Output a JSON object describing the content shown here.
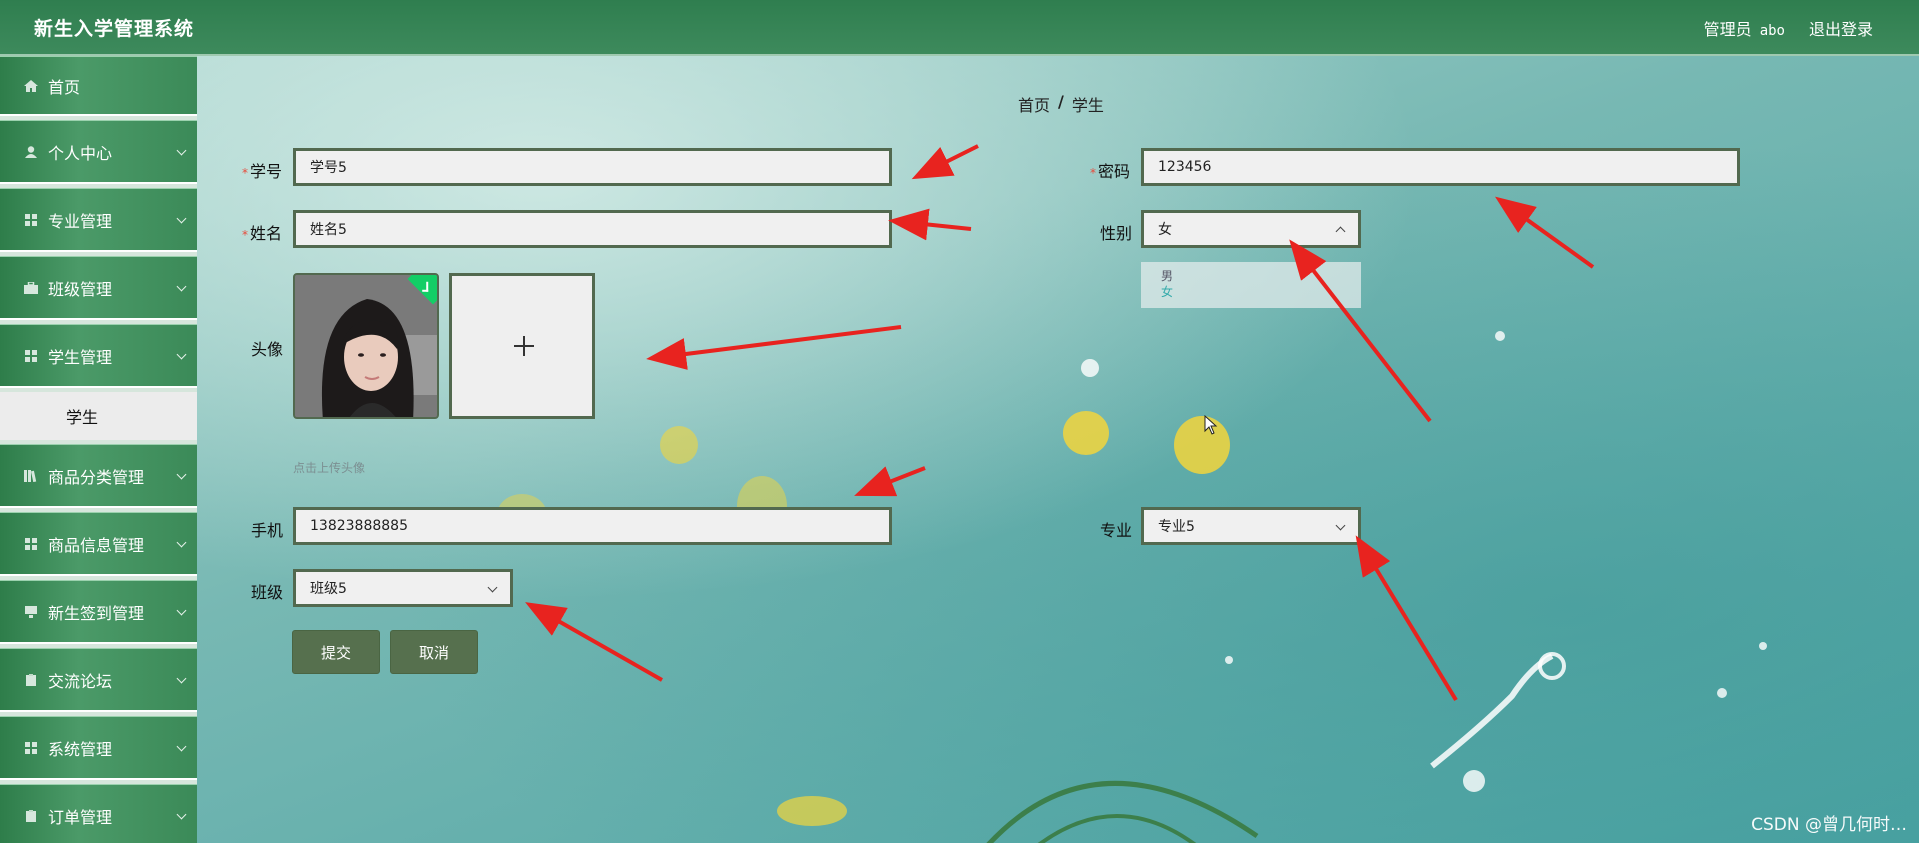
{
  "header": {
    "app_title": "新生入学管理系统",
    "user_role": "管理员",
    "user_name": "abo",
    "logout_label": "退出登录"
  },
  "sidebar": {
    "items": [
      {
        "label": "首页",
        "icon": "home-icon"
      },
      {
        "label": "个人中心",
        "icon": "user-icon"
      },
      {
        "label": "专业管理",
        "icon": "grid-icon"
      },
      {
        "label": "班级管理",
        "icon": "briefcase-icon"
      },
      {
        "label": "学生管理",
        "icon": "grid-icon"
      },
      {
        "label": "学生",
        "icon": ""
      },
      {
        "label": "商品分类管理",
        "icon": "books-icon"
      },
      {
        "label": "商品信息管理",
        "icon": "grid-icon"
      },
      {
        "label": "新生签到管理",
        "icon": "monitor-icon"
      },
      {
        "label": "交流论坛",
        "icon": "clipboard-icon"
      },
      {
        "label": "系统管理",
        "icon": "grid-icon"
      },
      {
        "label": "订单管理",
        "icon": "clipboard-icon"
      }
    ]
  },
  "breadcrumb": {
    "home": "首页",
    "sep": "/",
    "current": "学生"
  },
  "form": {
    "student_id": {
      "label": "学号",
      "value": "学号5"
    },
    "password": {
      "label": "密码",
      "value": "123456"
    },
    "name": {
      "label": "姓名",
      "value": "姓名5"
    },
    "gender": {
      "label": "性别",
      "value": "女",
      "options": [
        "男",
        "女"
      ]
    },
    "avatar": {
      "label": "头像",
      "hint": "点击上传头像"
    },
    "phone": {
      "label": "手机",
      "value": "13823888885"
    },
    "major": {
      "label": "专业",
      "value": "专业5"
    },
    "class": {
      "label": "班级",
      "value": "班级5"
    },
    "submit_label": "提交",
    "cancel_label": "取消"
  },
  "watermark": "CSDN @曾几何时…",
  "colors": {
    "header_green": "#2f7e4f",
    "button_green": "#56704e",
    "field_border": "#52694f",
    "annotation_red": "#e8231f"
  }
}
